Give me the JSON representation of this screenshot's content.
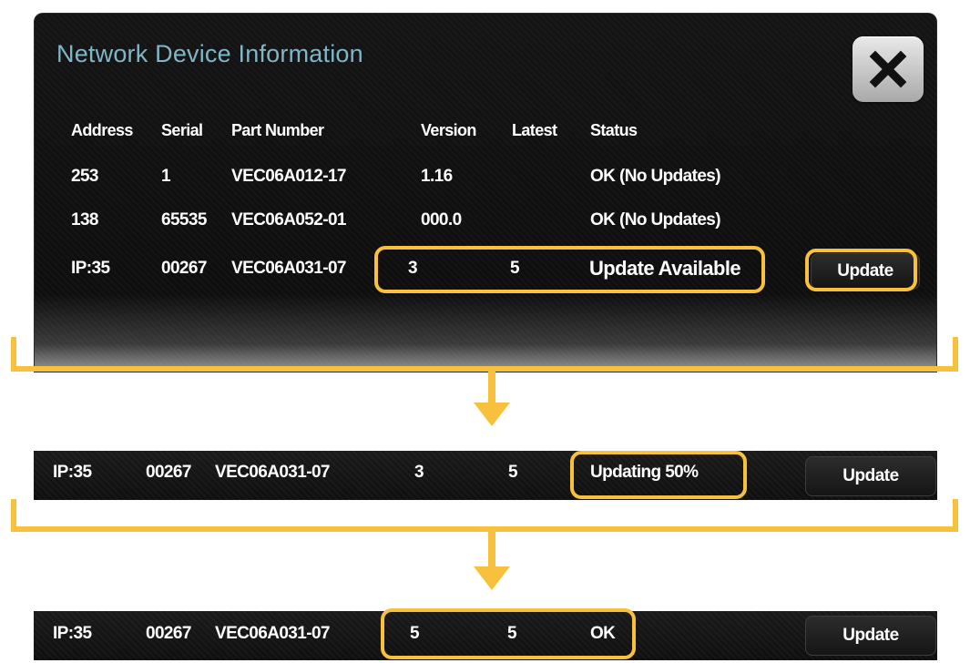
{
  "dialog": {
    "title": "Network Device Information",
    "close_icon": "close-x-icon",
    "columns": [
      "Address",
      "Serial",
      "Part Number",
      "Version",
      "Latest",
      "Status"
    ],
    "rows": [
      {
        "address": "253",
        "serial": "1",
        "part": "VEC06A012-17",
        "version": "1.16",
        "latest": "",
        "status": "OK (No Updates)"
      },
      {
        "address": "138",
        "serial": "65535",
        "part": "VEC06A052-01",
        "version": "000.0",
        "latest": "",
        "status": "OK (No Updates)"
      },
      {
        "address": "IP:35",
        "serial": "00267",
        "part": "VEC06A031-07",
        "version": "3",
        "latest": "5",
        "status": "Update Available",
        "button": "Update"
      }
    ]
  },
  "step2": {
    "address": "IP:35",
    "serial": "00267",
    "part": "VEC06A031-07",
    "version": "3",
    "latest": "5",
    "status": "Updating 50%",
    "button": "Update",
    "progress": 0.5
  },
  "step3": {
    "address": "IP:35",
    "serial": "00267",
    "part": "VEC06A031-07",
    "version": "5",
    "latest": "5",
    "status": "OK",
    "button": "Update"
  },
  "colors": {
    "highlight": "#f7c13e",
    "title": "#7fb6c8",
    "panel": "#111111"
  }
}
